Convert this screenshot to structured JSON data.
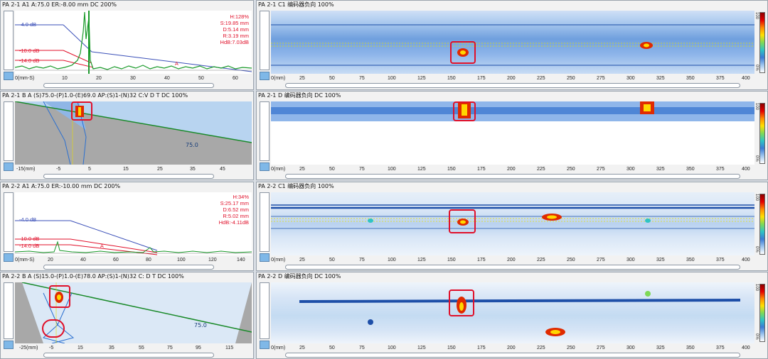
{
  "panels": {
    "p1": {
      "title": "PA 2-1 A1 A:75.0 ER:-8.00 mm DC 200%",
      "readout": [
        "H:128%",
        "S:19.85 mm",
        "D:5.14 mm",
        "R:3.19 mm",
        "HdB:7.03dB"
      ],
      "gain_labels": [
        "-4.0 dB",
        "-10.0 dB",
        "-14.0 dB"
      ],
      "x_ticks": [
        "0(mm-S)",
        "10",
        "20",
        "30",
        "40",
        "50",
        "60"
      ]
    },
    "p2": {
      "title": "PA 2-1 C1 编码器负向  100%",
      "x_ticks": [
        "0(mm)",
        "25",
        "50",
        "75",
        "100",
        "125",
        "150",
        "175",
        "200",
        "225",
        "250",
        "275",
        "300",
        "325",
        "350",
        "375",
        "400"
      ]
    },
    "p3": {
      "title": "PA 2-1 B A (S)75.0-(P)1.0-(E)69.0 AP:(S)1-(N)32 C:V D  T  DC 100%",
      "ang_label": "75.0",
      "x_ticks": [
        "-15(mm)",
        "-5",
        "5",
        "15",
        "25",
        "35",
        "45"
      ]
    },
    "p4": {
      "title": "PA 2-1 D 编码器负向 DC 100%",
      "x_ticks": [
        "0(mm)",
        "25",
        "50",
        "75",
        "100",
        "125",
        "150",
        "175",
        "200",
        "225",
        "250",
        "275",
        "300",
        "325",
        "350",
        "375",
        "400"
      ]
    },
    "p5": {
      "title": "PA 2-2 A1 A:75.0 ER:-10.00 mm DC 200%",
      "readout": [
        "H:34%",
        "S:25.17 mm",
        "D:6.52 mm",
        "R:5.02 mm",
        "HdB:-4.11dB"
      ],
      "gain_labels": [
        "-4.0 dB",
        "-10.0 dB",
        "-14.0 dB"
      ],
      "x_ticks": [
        "0(mm-S)",
        "20",
        "40",
        "60",
        "80",
        "100",
        "120",
        "140"
      ]
    },
    "p6": {
      "title": "PA 2-2 C1 编码器负向  100%",
      "x_ticks": [
        "0(mm)",
        "25",
        "50",
        "75",
        "100",
        "125",
        "150",
        "175",
        "200",
        "225",
        "250",
        "275",
        "300",
        "325",
        "350",
        "375",
        "400"
      ]
    },
    "p7": {
      "title": "PA 2-2 B A (S)15.0-(P)1.0-(E)78.0 AP:(S)1-(N)32 C: D  T  DC 100%",
      "ang_label": "75.0",
      "x_ticks": [
        "-25(mm)",
        "-5",
        "15",
        "35",
        "55",
        "75",
        "95",
        "115"
      ]
    },
    "p8": {
      "title": "PA 2-2 D 编码器负向 DC 100%",
      "x_ticks": [
        "0(mm)",
        "25",
        "50",
        "75",
        "100",
        "125",
        "150",
        "175",
        "200",
        "225",
        "250",
        "275",
        "300",
        "325",
        "350",
        "375",
        "400"
      ]
    }
  },
  "colorbar": {
    "top": "100",
    "bottom": "0%"
  },
  "colors": {
    "title_bg": "#f2f2f2",
    "accent_red": "#e0102a",
    "scan_blue": "#2a5fb8"
  }
}
